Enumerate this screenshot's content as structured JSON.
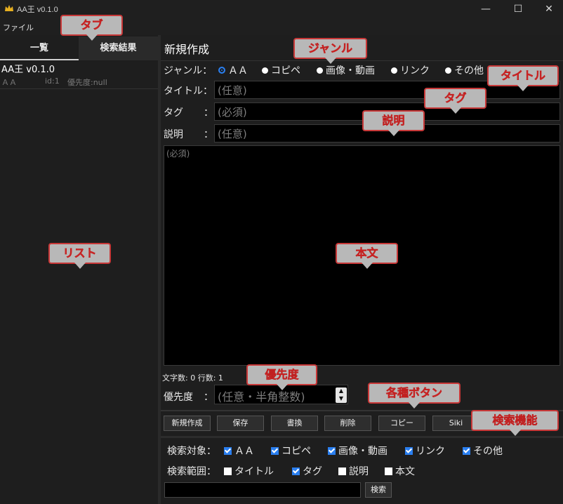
{
  "window": {
    "title": "AA王 v0.1.0",
    "minimize": "—",
    "maximize": "☐",
    "close": "✕"
  },
  "menu": {
    "file": "ファイル"
  },
  "tabs": {
    "list": "一覧",
    "search_results": "検索結果"
  },
  "list_items": [
    {
      "title": "AA王 v0.1.0",
      "genre": "ＡＡ",
      "id": "id:1",
      "priority": "優先度:null"
    }
  ],
  "editor": {
    "heading": "新規作成",
    "genre_label": "ジャンル：",
    "genres": [
      "ＡＡ",
      "コピペ",
      "画像・動画",
      "リンク",
      "その他"
    ],
    "selected_genre": "ＡＡ",
    "title_label": "タイトル：",
    "title_placeholder": "(任意)",
    "tag_label": "タグ",
    "tag_colon": "：",
    "tag_placeholder": "(必須)",
    "desc_label": "説明",
    "desc_colon": "：",
    "desc_placeholder": "(任意)",
    "body_placeholder": "(必須)",
    "counts": "文字数: 0 行数: 1",
    "priority_label": "優先度",
    "priority_colon": "：",
    "priority_placeholder": "(任意・半角整数)"
  },
  "buttons": [
    "新規作成",
    "保存",
    "書換",
    "削除",
    "コピー",
    "Siki"
  ],
  "search": {
    "target_label": "検索対象：",
    "targets": [
      {
        "label": "ＡＡ",
        "checked": true
      },
      {
        "label": "コピペ",
        "checked": true
      },
      {
        "label": "画像・動画",
        "checked": true
      },
      {
        "label": "リンク",
        "checked": true
      },
      {
        "label": "その他",
        "checked": true
      }
    ],
    "range_label": "検索範囲：",
    "ranges": [
      {
        "label": "タイトル",
        "checked": false
      },
      {
        "label": "タグ",
        "checked": true
      },
      {
        "label": "説明",
        "checked": false
      },
      {
        "label": "本文",
        "checked": false
      }
    ],
    "button": "検索"
  },
  "callouts": {
    "tab": "タブ",
    "genre": "ジャンル",
    "title": "タイトル",
    "tag": "タグ",
    "description": "説明",
    "list": "リスト",
    "body": "本文",
    "priority": "優先度",
    "buttons": "各種ボタン",
    "search": "検索機能"
  },
  "colors": {
    "accent": "#2a7ff0",
    "callout_text": "#e83030",
    "callout_bg": "#b8b8b8"
  }
}
